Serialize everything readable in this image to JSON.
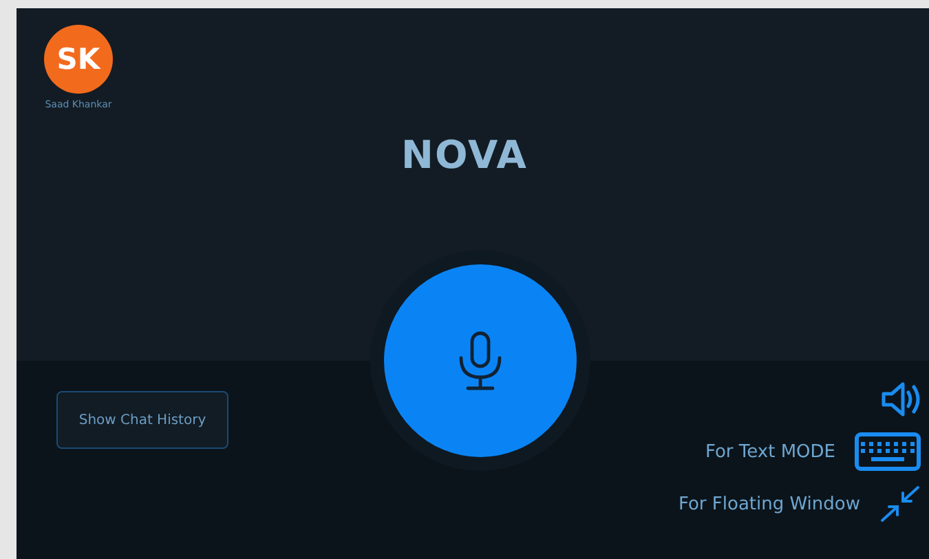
{
  "user": {
    "initials": "SK",
    "name": "Saad Khankar"
  },
  "title": "NOVA",
  "history_button": {
    "label": "Show Chat History"
  },
  "actions": [
    {
      "kind": "speaker"
    },
    {
      "kind": "keyboard",
      "label": "For Text MODE"
    },
    {
      "kind": "shrink",
      "label": "For Floating Window"
    }
  ]
}
